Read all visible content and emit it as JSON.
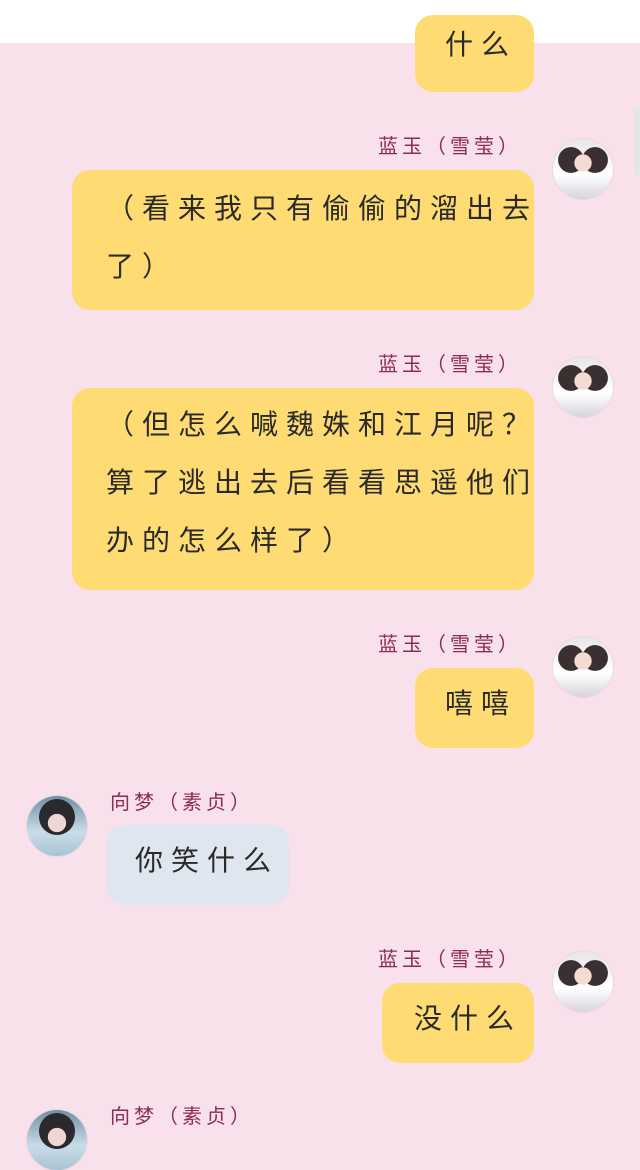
{
  "speakers": {
    "lanyu": {
      "name": "蓝玉（雪莹）"
    },
    "xiangmeng": {
      "name": "向梦（素贞）"
    }
  },
  "messages": [
    {
      "text": "什么"
    },
    {
      "lines": [
        "（看来我只有偷偷的溜出去",
        "了）"
      ]
    },
    {
      "lines": [
        "（但怎么喊魏姝和江月呢？",
        "算了逃出去后看看思遥他们",
        "办的怎么样了）"
      ]
    },
    {
      "text": "嘻嘻"
    },
    {
      "text": "你笑什么"
    },
    {
      "text": "没什么"
    }
  ],
  "colors": {
    "background": "#f9e1ec",
    "bubble_self": "#ffdc73",
    "bubble_other": "#dfe6ef",
    "name_text": "#8a2c55"
  }
}
